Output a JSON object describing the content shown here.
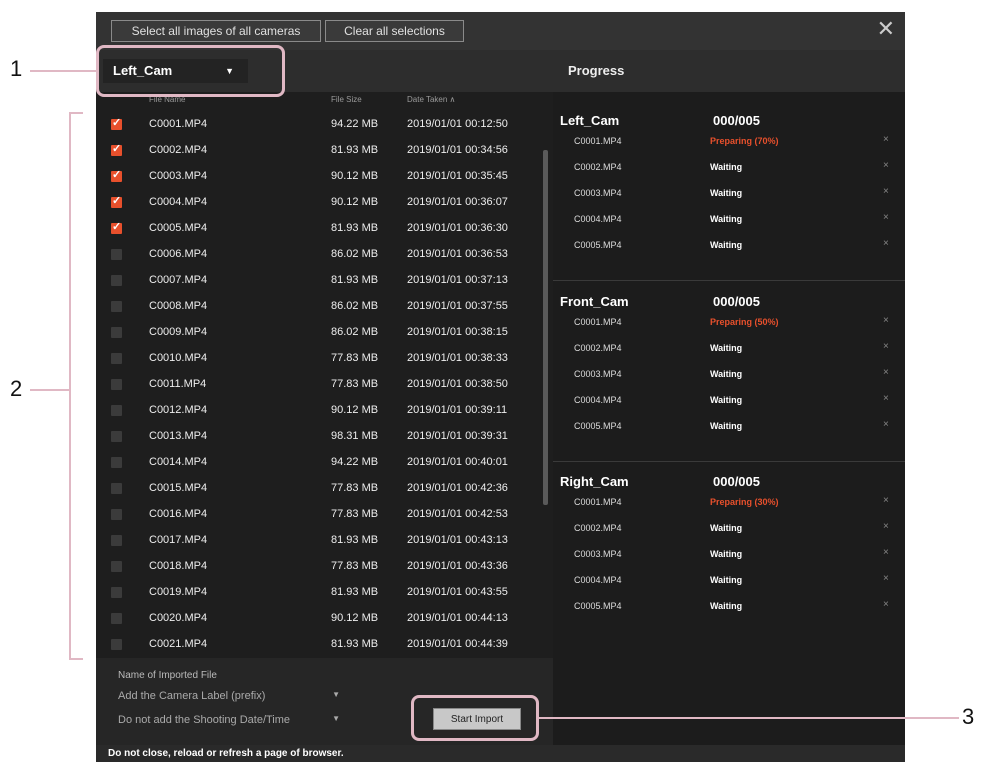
{
  "topbar": {
    "select_all": "Select all images of all cameras",
    "clear_all": "Clear all selections",
    "close": "✕"
  },
  "camera_select": {
    "value": "Left_Cam",
    "arrow": "▼"
  },
  "columns": {
    "file_name": "File Name",
    "file_size": "File Size",
    "date_taken": "Date Taken ∧"
  },
  "files": [
    {
      "name": "C0001.MP4",
      "size": "94.22 MB",
      "date": "2019/01/01 00:12:50",
      "checked": true
    },
    {
      "name": "C0002.MP4",
      "size": "81.93 MB",
      "date": "2019/01/01 00:34:56",
      "checked": true
    },
    {
      "name": "C0003.MP4",
      "size": "90.12 MB",
      "date": "2019/01/01 00:35:45",
      "checked": true
    },
    {
      "name": "C0004.MP4",
      "size": "90.12 MB",
      "date": "2019/01/01 00:36:07",
      "checked": true
    },
    {
      "name": "C0005.MP4",
      "size": "81.93 MB",
      "date": "2019/01/01 00:36:30",
      "checked": true
    },
    {
      "name": "C0006.MP4",
      "size": "86.02 MB",
      "date": "2019/01/01 00:36:53",
      "checked": false
    },
    {
      "name": "C0007.MP4",
      "size": "81.93 MB",
      "date": "2019/01/01 00:37:13",
      "checked": false
    },
    {
      "name": "C0008.MP4",
      "size": "86.02 MB",
      "date": "2019/01/01 00:37:55",
      "checked": false
    },
    {
      "name": "C0009.MP4",
      "size": "86.02 MB",
      "date": "2019/01/01 00:38:15",
      "checked": false
    },
    {
      "name": "C0010.MP4",
      "size": "77.83 MB",
      "date": "2019/01/01 00:38:33",
      "checked": false
    },
    {
      "name": "C0011.MP4",
      "size": "77.83 MB",
      "date": "2019/01/01 00:38:50",
      "checked": false
    },
    {
      "name": "C0012.MP4",
      "size": "90.12 MB",
      "date": "2019/01/01 00:39:11",
      "checked": false
    },
    {
      "name": "C0013.MP4",
      "size": "98.31 MB",
      "date": "2019/01/01 00:39:31",
      "checked": false
    },
    {
      "name": "C0014.MP4",
      "size": "94.22 MB",
      "date": "2019/01/01 00:40:01",
      "checked": false
    },
    {
      "name": "C0015.MP4",
      "size": "77.83 MB",
      "date": "2019/01/01 00:42:36",
      "checked": false
    },
    {
      "name": "C0016.MP4",
      "size": "77.83 MB",
      "date": "2019/01/01 00:42:53",
      "checked": false
    },
    {
      "name": "C0017.MP4",
      "size": "81.93 MB",
      "date": "2019/01/01 00:43:13",
      "checked": false
    },
    {
      "name": "C0018.MP4",
      "size": "77.83 MB",
      "date": "2019/01/01 00:43:36",
      "checked": false
    },
    {
      "name": "C0019.MP4",
      "size": "81.93 MB",
      "date": "2019/01/01 00:43:55",
      "checked": false
    },
    {
      "name": "C0020.MP4",
      "size": "90.12 MB",
      "date": "2019/01/01 00:44:13",
      "checked": false
    },
    {
      "name": "C0021.MP4",
      "size": "81.93 MB",
      "date": "2019/01/01 00:44:39",
      "checked": false
    }
  ],
  "import_options": {
    "label": "Name of Imported File",
    "prefix": "Add the Camera Label (prefix)",
    "date": "Do not add the Shooting Date/Time",
    "arrow": "▼",
    "start": "Start Import"
  },
  "progress": {
    "title": "Progress",
    "groups": [
      {
        "camera": "Left_Cam",
        "count": "000/005",
        "items": [
          {
            "file": "C0001.MP4",
            "status": "Preparing (70%)",
            "preparing": true
          },
          {
            "file": "C0002.MP4",
            "status": "Waiting",
            "preparing": false
          },
          {
            "file": "C0003.MP4",
            "status": "Waiting",
            "preparing": false
          },
          {
            "file": "C0004.MP4",
            "status": "Waiting",
            "preparing": false
          },
          {
            "file": "C0005.MP4",
            "status": "Waiting",
            "preparing": false
          }
        ]
      },
      {
        "camera": "Front_Cam",
        "count": "000/005",
        "items": [
          {
            "file": "C0001.MP4",
            "status": "Preparing (50%)",
            "preparing": true
          },
          {
            "file": "C0002.MP4",
            "status": "Waiting",
            "preparing": false
          },
          {
            "file": "C0003.MP4",
            "status": "Waiting",
            "preparing": false
          },
          {
            "file": "C0004.MP4",
            "status": "Waiting",
            "preparing": false
          },
          {
            "file": "C0005.MP4",
            "status": "Waiting",
            "preparing": false
          }
        ]
      },
      {
        "camera": "Right_Cam",
        "count": "000/005",
        "items": [
          {
            "file": "C0001.MP4",
            "status": "Preparing (30%)",
            "preparing": true
          },
          {
            "file": "C0002.MP4",
            "status": "Waiting",
            "preparing": false
          },
          {
            "file": "C0003.MP4",
            "status": "Waiting",
            "preparing": false
          },
          {
            "file": "C0004.MP4",
            "status": "Waiting",
            "preparing": false
          },
          {
            "file": "C0005.MP4",
            "status": "Waiting",
            "preparing": false
          }
        ]
      }
    ],
    "remove_glyph": "×"
  },
  "footer": "Do not close, reload or refresh a page of browser.",
  "callouts": {
    "one": "1",
    "two": "2",
    "three": "3"
  },
  "colors": {
    "accent": "#e8502c",
    "callout": "#e0b8c4"
  }
}
